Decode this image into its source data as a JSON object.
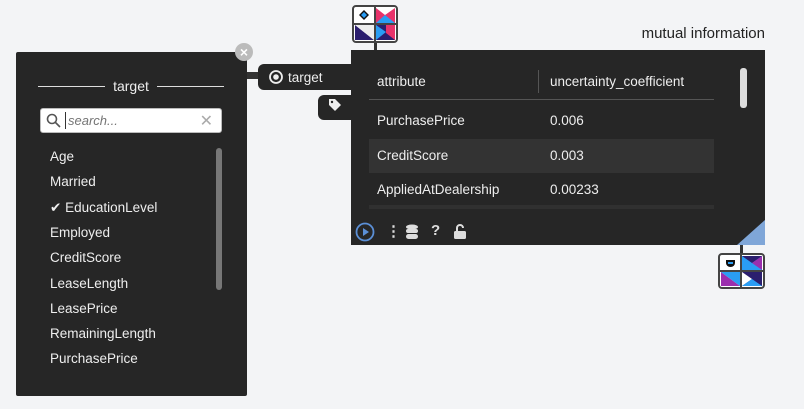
{
  "top_node": {
    "icon": "matrix-widget-icon"
  },
  "bottom_node": {
    "icon": "widget-output-icon"
  },
  "left_panel": {
    "title": "target",
    "search": {
      "placeholder": "search...",
      "value": ""
    },
    "items": [
      {
        "label": "Age",
        "checked": false
      },
      {
        "label": "Married",
        "checked": false
      },
      {
        "label": "EducationLevel",
        "checked": true
      },
      {
        "label": "Employed",
        "checked": false
      },
      {
        "label": "CreditScore",
        "checked": false
      },
      {
        "label": "LeaseLength",
        "checked": false
      },
      {
        "label": "LeasePrice",
        "checked": false
      },
      {
        "label": "RemainingLength",
        "checked": false
      },
      {
        "label": "PurchasePrice",
        "checked": false
      }
    ]
  },
  "connector": {
    "target_label": "target"
  },
  "right_panel": {
    "title": "mutual information",
    "columns": [
      "attribute",
      "uncertainty_coefficient"
    ],
    "rows": [
      [
        "PurchasePrice",
        "0.006"
      ],
      [
        "CreditScore",
        "0.003"
      ],
      [
        "AppliedAtDealership",
        "0.00233"
      ]
    ],
    "toolbar": [
      "play-icon",
      "more-icon",
      "database-icon",
      "help-icon",
      "unlock-icon"
    ]
  },
  "colors": {
    "panel": "#262626",
    "accent": "#7fa6d8",
    "play": "#5b8fd6"
  }
}
